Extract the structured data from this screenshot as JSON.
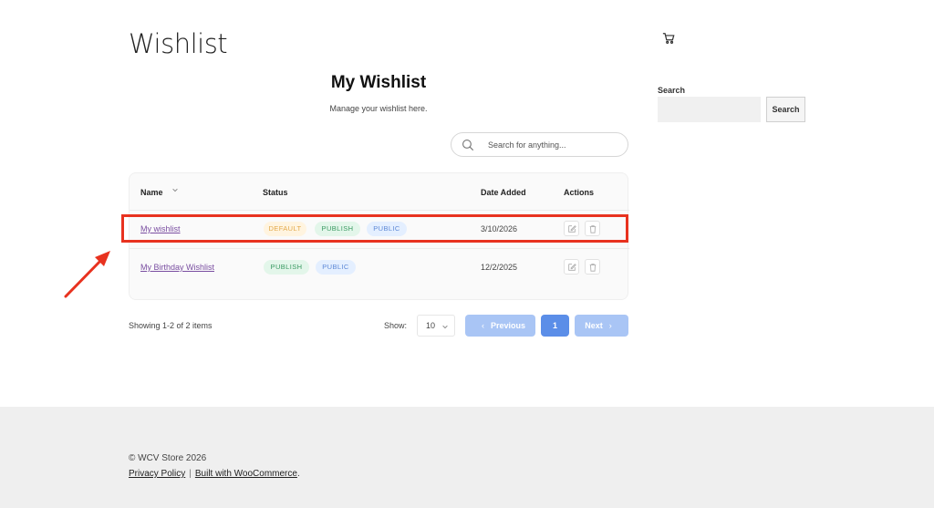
{
  "page": {
    "title": "Wishlist"
  },
  "wishlist": {
    "title": "My Wishlist",
    "subtitle": "Manage your wishlist here.",
    "search_placeholder": "Search for anything..."
  },
  "table": {
    "headers": {
      "name": "Name",
      "status": "Status",
      "date_added": "Date Added",
      "actions": "Actions"
    },
    "rows": [
      {
        "name": "My wishlist",
        "badges": [
          "DEFAULT",
          "PUBLISH",
          "PUBLIC"
        ],
        "date": "3/10/2026",
        "highlighted": true
      },
      {
        "name": "My Birthday Wishlist",
        "badges": [
          "PUBLISH",
          "PUBLIC"
        ],
        "date": "12/2/2025",
        "highlighted": false
      }
    ]
  },
  "pagination": {
    "showing": "Showing 1-2 of 2 items",
    "show_label": "Show:",
    "per_page": "10",
    "previous": "Previous",
    "current_page": "1",
    "next": "Next"
  },
  "sidebar": {
    "search_label": "Search",
    "search_button": "Search"
  },
  "footer": {
    "copyright": "© WCV Store 2026",
    "privacy": "Privacy Policy",
    "separator": "|",
    "built_with": "Built with WooCommerce",
    "trailing": "."
  },
  "colors": {
    "accent": "#5b8ee8",
    "annotation": "#e8321f",
    "link": "#7a4ea1"
  },
  "icons": {
    "cart": "cart-icon",
    "search": "search-icon",
    "edit": "edit-icon",
    "delete": "trash-icon"
  }
}
